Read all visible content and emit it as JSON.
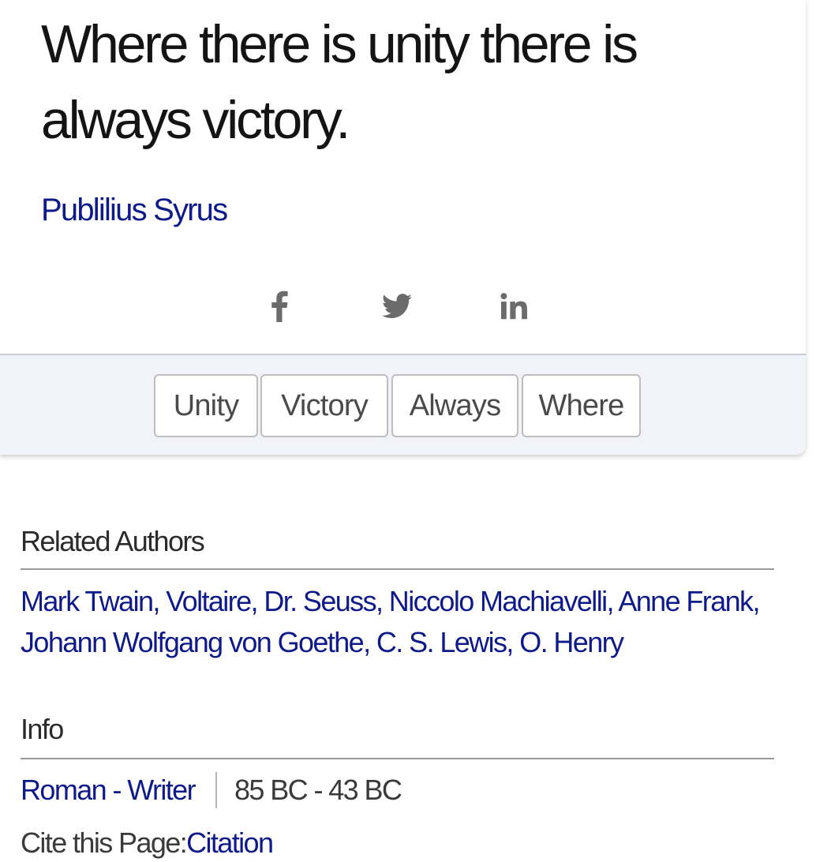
{
  "quote": {
    "text": "Where there is unity there is always victory.",
    "author": "Publilius Syrus"
  },
  "share": {
    "icons": [
      "facebook-icon",
      "twitter-icon",
      "linkedin-icon"
    ],
    "icon_color": "#6b6b6b"
  },
  "tags": [
    "Unity",
    "Victory",
    "Always",
    "Where"
  ],
  "related": {
    "title": "Related Authors",
    "authors": [
      "Mark Twain",
      "Voltaire",
      "Dr. Seuss",
      "Niccolo Machiavelli",
      "Anne Frank",
      "Johann Wolfgang von Goethe",
      "C. S. Lewis",
      "O. Henry"
    ]
  },
  "info": {
    "title": "Info",
    "nationality": "Roman",
    "profession": "Writer",
    "profession_link": "Roman - Writer",
    "dates": "85 BC - 43 BC",
    "cite_label": "Cite this Page:",
    "cite_link": "Citation"
  },
  "colors": {
    "link": "#0e1a8a",
    "tag_bar_bg": "#f1f3f8",
    "text": "#141414"
  }
}
